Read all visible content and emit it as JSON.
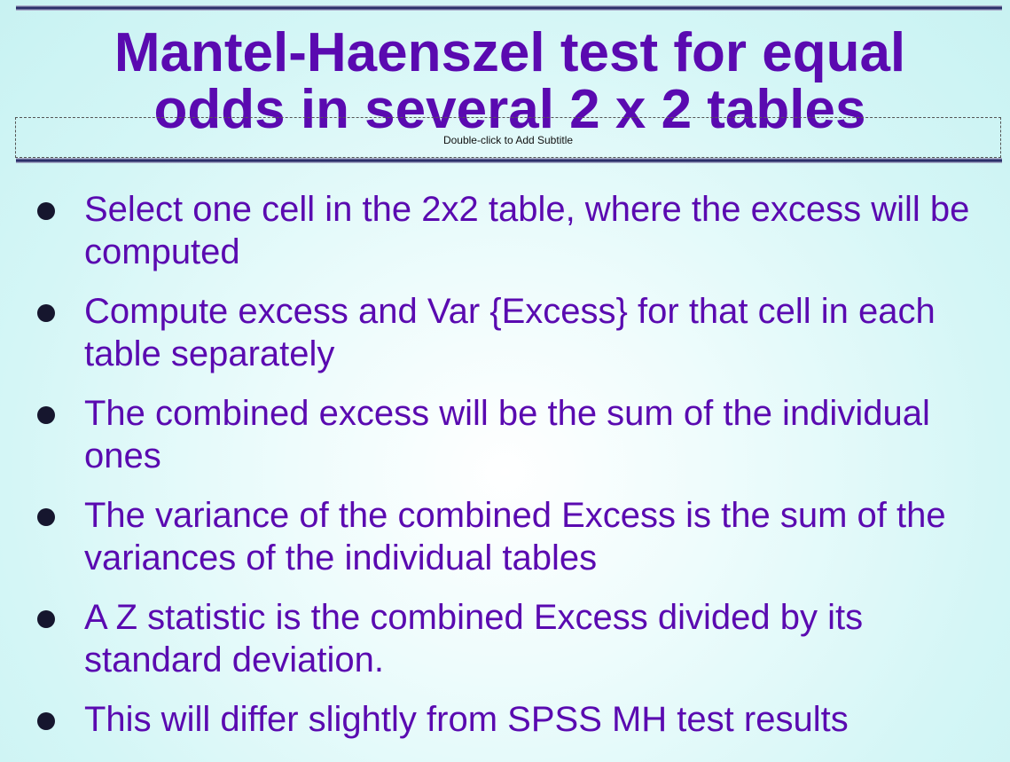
{
  "slide": {
    "title": "Mantel-Haenszel test for equal\nodds in several 2 x 2 tables",
    "subtitle_placeholder": "Double-click to Add Subtitle",
    "bullets": [
      "Select one cell in the 2x2 table, where the excess will be computed",
      "Compute excess and Var {Excess} for that cell in each table separately",
      "The combined excess will be the sum of the individual ones",
      "The variance of the combined Excess is the sum of the variances of the individual tables",
      "A Z statistic is the combined Excess divided by its standard deviation.",
      "This will differ slightly from SPSS MH test results"
    ]
  },
  "colors": {
    "text": "#5a0ab0",
    "bullet_dot": "#16162e",
    "background": "#d4f6f6",
    "rule": "#262a66"
  }
}
